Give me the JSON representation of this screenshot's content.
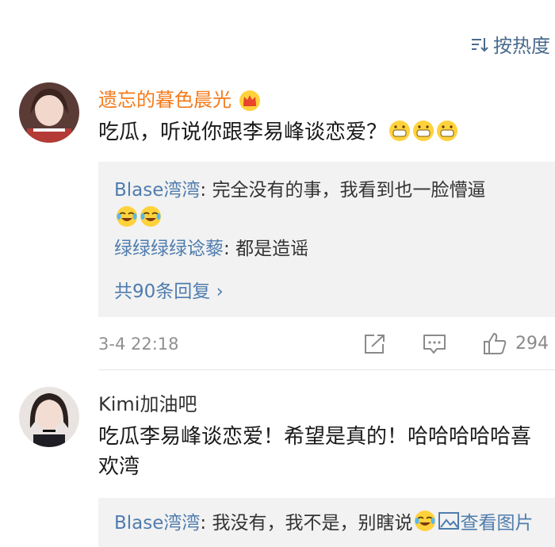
{
  "sort": {
    "label": "按热度"
  },
  "comments": [
    {
      "username": "遗忘的暮色晨光",
      "text": "吃瓜，听说你跟李易峰谈恋爱？",
      "replies": [
        {
          "name": "Blase湾湾",
          "sep": ": ",
          "text": "完全没有的事，我看到也一脸懵逼"
        },
        {
          "name": "绿绿绿绿谂藜",
          "sep": ": ",
          "text": "都是造谣"
        }
      ],
      "more_replies": "共90条回复 ›",
      "time": "3-4 22:18",
      "likes": "294"
    },
    {
      "username": "Kimi加油吧",
      "text": "吃瓜李易峰谈恋爱！希望是真的！哈哈哈哈哈喜欢湾",
      "replies": [
        {
          "name": "Blase湾湾",
          "sep": ": ",
          "text": "我没有，我不是，别瞎说",
          "extra": "查看图片"
        }
      ]
    }
  ],
  "colors": {
    "link": "#4f7cae",
    "vip_name": "#f47b1c",
    "reply_bg": "#f2f2f2"
  }
}
